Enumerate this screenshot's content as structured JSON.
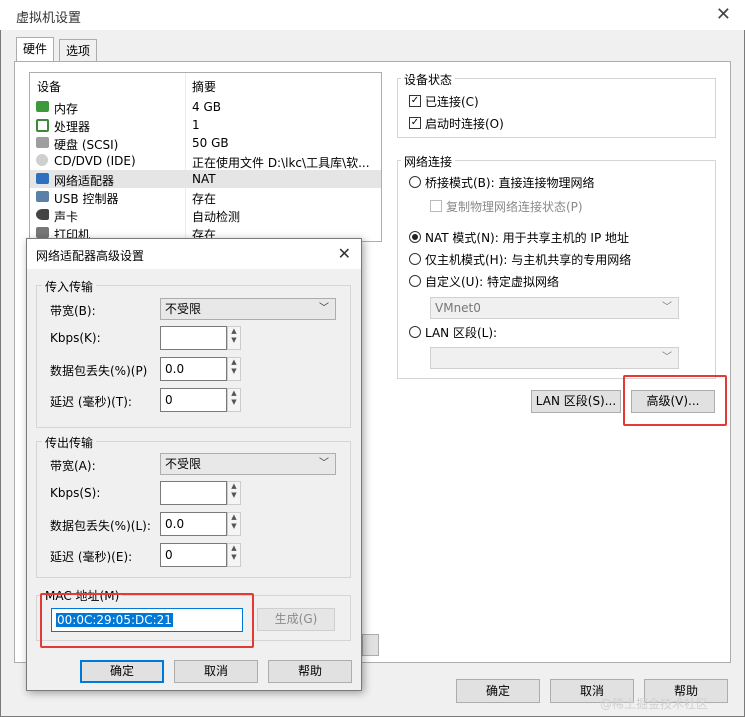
{
  "window": {
    "title": "虚拟机设置"
  },
  "tabs": [
    {
      "label": "硬件"
    },
    {
      "label": "选项"
    }
  ],
  "device_list": {
    "headers": {
      "device": "设备",
      "summary": "摘要"
    },
    "rows": [
      {
        "name": "内存",
        "summary": "4 GB",
        "icon": "memory-icon"
      },
      {
        "name": "处理器",
        "summary": "1",
        "icon": "cpu-icon"
      },
      {
        "name": "硬盘 (SCSI)",
        "summary": "50 GB",
        "icon": "harddisk-icon"
      },
      {
        "name": "CD/DVD (IDE)",
        "summary": "正在使用文件 D:\\lkc\\工具库\\软...",
        "icon": "cdrom-icon"
      },
      {
        "name": "网络适配器",
        "summary": "NAT",
        "icon": "network-adapter-icon"
      },
      {
        "name": "USB 控制器",
        "summary": "存在",
        "icon": "usb-icon"
      },
      {
        "name": "声卡",
        "summary": "自动检测",
        "icon": "sound-icon"
      },
      {
        "name": "打印机",
        "summary": "存在",
        "icon": "printer-icon"
      }
    ]
  },
  "device_status": {
    "label": "设备状态",
    "connected": "已连接(C)",
    "connect_at_power_on": "启动时连接(O)"
  },
  "network_connection": {
    "label": "网络连接",
    "bridged": "桥接模式(B): 直接连接物理网络",
    "replicate": "复制物理网络连接状态(P)",
    "nat": "NAT 模式(N): 用于共享主机的 IP 地址",
    "host_only": "仅主机模式(H): 与主机共享的专用网络",
    "custom": "自定义(U): 特定虚拟网络",
    "custom_value": "VMnet0",
    "lan_segment": "LAN 区段(L):",
    "lan_segment_value": ""
  },
  "buttons": {
    "lan_segments": "LAN 区段(S)...",
    "advanced": "高级(V)...",
    "ok": "确定",
    "cancel": "取消",
    "help": "帮助"
  },
  "advanced_dialog": {
    "title": "网络适配器高级设置",
    "incoming": {
      "label": "传入传输",
      "bandwidth_label": "带宽(B):",
      "bandwidth_value": "不受限",
      "kbps_label": "Kbps(K):",
      "kbps_value": "",
      "loss_label": "数据包丢失(%)(P)",
      "loss_value": "0.0",
      "latency_label": "延迟 (毫秒)(T):",
      "latency_value": "0"
    },
    "outgoing": {
      "label": "传出传输",
      "bandwidth_label": "带宽(A):",
      "bandwidth_value": "不受限",
      "kbps_label": "Kbps(S):",
      "kbps_value": "",
      "loss_label": "数据包丢失(%)(L):",
      "loss_value": "0.0",
      "latency_label": "延迟 (毫秒)(E):",
      "latency_value": "0"
    },
    "mac": {
      "label": "MAC 地址(M)",
      "value": "00:0C:29:05:DC:21",
      "generate": "生成(G)"
    },
    "ok": "确定",
    "cancel": "取消",
    "help": "帮助"
  },
  "watermark": "@稀土掘金技术社区",
  "colors": {
    "highlight_red": "#e53935",
    "selection_blue": "#0078d7"
  }
}
